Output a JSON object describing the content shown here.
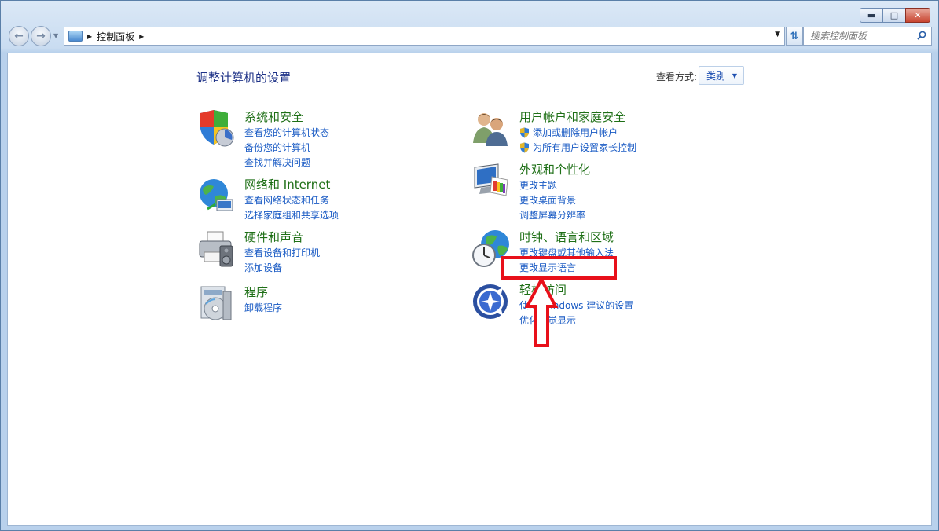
{
  "window": {
    "controls": {
      "minimize_icon": "minimize-icon",
      "maximize_icon": "maximize-icon",
      "close_icon": "close-icon"
    }
  },
  "address_bar": {
    "breadcrumb": [
      "控制面板"
    ]
  },
  "search": {
    "placeholder": "搜索控制面板"
  },
  "header": {
    "title": "调整计算机的设置",
    "view_label": "查看方式:",
    "view_value": "类别"
  },
  "categories": [
    {
      "title": "系统和安全",
      "icon": "shield-icon",
      "links": [
        "查看您的计算机状态",
        "备份您的计算机",
        "查找并解决问题"
      ]
    },
    {
      "title": "网络和 Internet",
      "icon": "globe-network-icon",
      "links": [
        "查看网络状态和任务",
        "选择家庭组和共享选项"
      ]
    },
    {
      "title": "硬件和声音",
      "icon": "printer-icon",
      "links": [
        "查看设备和打印机",
        "添加设备"
      ]
    },
    {
      "title": "程序",
      "icon": "programs-icon",
      "links": [
        "卸载程序"
      ]
    },
    {
      "title": "用户帐户和家庭安全",
      "icon": "users-icon",
      "links": [
        "添加或删除用户帐户",
        "为所有用户设置家长控制"
      ]
    },
    {
      "title": "外观和个性化",
      "icon": "monitor-palette-icon",
      "links": [
        "更改主题",
        "更改桌面背景",
        "调整屏幕分辨率"
      ]
    },
    {
      "title": "时钟、语言和区域",
      "icon": "clock-globe-icon",
      "links": [
        "更改键盘或其他输入法",
        "更改显示语言"
      ]
    },
    {
      "title": "轻松访问",
      "icon": "ease-of-access-icon",
      "links": [
        "使用 Windows 建议的设置",
        "优化视觉显示"
      ]
    }
  ],
  "colors": {
    "title_blue": "#1e3287",
    "category_green": "#1e6f16",
    "link_blue": "#1a5bc4",
    "annotation_red": "#e8101a"
  }
}
